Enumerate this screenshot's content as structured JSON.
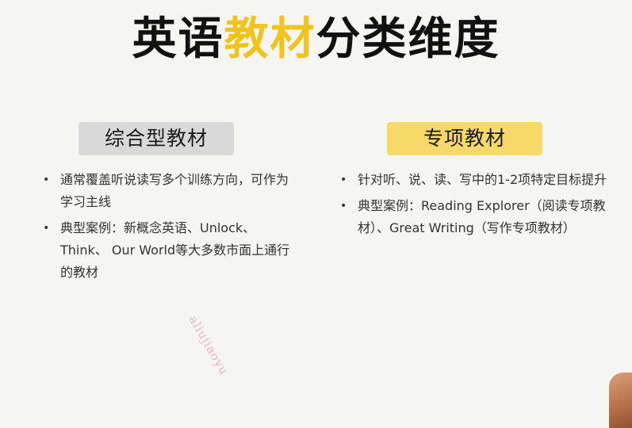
{
  "title": {
    "part1": "英语",
    "highlight": "教材",
    "part2": "分类维度"
  },
  "left_column": {
    "badge": "综合型教材",
    "bullets": [
      "通常覆盖听说读写多个训练方向，可作为学习主线",
      "典型案例：新概念英语、Unlock、Think、 Our World等大多数市面上通行的教材"
    ]
  },
  "right_column": {
    "badge": "专项教材",
    "bullets": [
      "针对听、说、读、写中的1-2项特定目标提升",
      "典型案例：Reading Explorer（阅读专项教材）、Great Writing（写作专项教材）"
    ]
  },
  "bullet_glyph": "•",
  "watermark": "aliujiaoyu",
  "colors": {
    "accent": "#f0c419",
    "left_badge_bg": "#d9d9d9",
    "right_badge_bg": "#f7d96a",
    "watermark": "#ec7896"
  }
}
